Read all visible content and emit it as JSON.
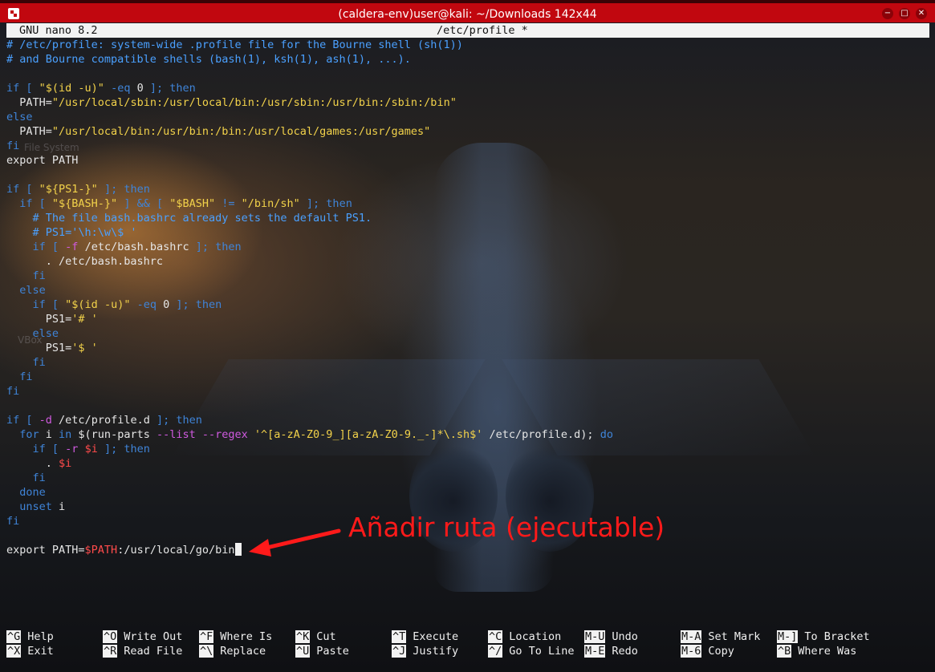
{
  "window": {
    "title": "(caldera-env)user@kali: ~/Downloads 142x44"
  },
  "nano": {
    "version": "GNU nano 8.2",
    "filename": "/etc/profile *"
  },
  "desktop_ghosts": {
    "file_system": "File System",
    "vbox": "VBox"
  },
  "editor_lines": [
    [
      {
        "t": "# /etc/profile: system-wide .profile file for the Bourne shell (sh(1))",
        "c": "c"
      }
    ],
    [
      {
        "t": "# and Bourne compatible shells (bash(1), ksh(1), ash(1), ...).",
        "c": "c"
      }
    ],
    [],
    [
      {
        "t": "if",
        "c": "k"
      },
      {
        "t": " [ ",
        "c": "k"
      },
      {
        "t": "\"$(id -u)\"",
        "c": "s"
      },
      {
        "t": " -eq ",
        "c": "k"
      },
      {
        "t": "0",
        "c": ""
      },
      {
        "t": " ]; then",
        "c": "k"
      }
    ],
    [
      {
        "t": "  PATH=",
        "c": ""
      },
      {
        "t": "\"/usr/local/sbin:/usr/local/bin:/usr/sbin:/usr/bin:/sbin:/bin\"",
        "c": "s"
      }
    ],
    [
      {
        "t": "else",
        "c": "k"
      }
    ],
    [
      {
        "t": "  PATH=",
        "c": ""
      },
      {
        "t": "\"/usr/local/bin:/usr/bin:/bin:/usr/local/games:/usr/games\"",
        "c": "s"
      }
    ],
    [
      {
        "t": "fi",
        "c": "k"
      }
    ],
    [
      {
        "t": "export PATH",
        "c": ""
      }
    ],
    [],
    [
      {
        "t": "if",
        "c": "k"
      },
      {
        "t": " [ ",
        "c": "k"
      },
      {
        "t": "\"${PS1-}\"",
        "c": "s"
      },
      {
        "t": " ]; then",
        "c": "k"
      }
    ],
    [
      {
        "t": "  if",
        "c": "k"
      },
      {
        "t": " [ ",
        "c": "k"
      },
      {
        "t": "\"${BASH-}\"",
        "c": "s"
      },
      {
        "t": " ] && [ ",
        "c": "k"
      },
      {
        "t": "\"$BASH\"",
        "c": "s"
      },
      {
        "t": " != ",
        "c": "k"
      },
      {
        "t": "\"/bin/sh\"",
        "c": "s"
      },
      {
        "t": " ]; then",
        "c": "k"
      }
    ],
    [
      {
        "t": "    # The file bash.bashrc already sets the default PS1.",
        "c": "c"
      }
    ],
    [
      {
        "t": "    # PS1='\\h:\\w\\$ '",
        "c": "c"
      }
    ],
    [
      {
        "t": "    if",
        "c": "k"
      },
      {
        "t": " [ ",
        "c": "k"
      },
      {
        "t": "-f",
        "c": "m"
      },
      {
        "t": " /etc/bash.bashrc ",
        "c": ""
      },
      {
        "t": "]; then",
        "c": "k"
      }
    ],
    [
      {
        "t": "      . /etc/bash.bashrc",
        "c": ""
      }
    ],
    [
      {
        "t": "    fi",
        "c": "k"
      }
    ],
    [
      {
        "t": "  else",
        "c": "k"
      }
    ],
    [
      {
        "t": "    if",
        "c": "k"
      },
      {
        "t": " [ ",
        "c": "k"
      },
      {
        "t": "\"$(id -u)\"",
        "c": "s"
      },
      {
        "t": " -eq ",
        "c": "k"
      },
      {
        "t": "0",
        "c": ""
      },
      {
        "t": " ]; then",
        "c": "k"
      }
    ],
    [
      {
        "t": "      PS1=",
        "c": ""
      },
      {
        "t": "'# '",
        "c": "s"
      }
    ],
    [
      {
        "t": "    else",
        "c": "k"
      }
    ],
    [
      {
        "t": "      PS1=",
        "c": ""
      },
      {
        "t": "'$ '",
        "c": "s"
      }
    ],
    [
      {
        "t": "    fi",
        "c": "k"
      }
    ],
    [
      {
        "t": "  fi",
        "c": "k"
      }
    ],
    [
      {
        "t": "fi",
        "c": "k"
      }
    ],
    [],
    [
      {
        "t": "if",
        "c": "k"
      },
      {
        "t": " [ ",
        "c": "k"
      },
      {
        "t": "-d",
        "c": "m"
      },
      {
        "t": " /etc/profile.d ",
        "c": ""
      },
      {
        "t": "]; then",
        "c": "k"
      }
    ],
    [
      {
        "t": "  for",
        "c": "k"
      },
      {
        "t": " i ",
        "c": ""
      },
      {
        "t": "in",
        "c": "k"
      },
      {
        "t": " $(run-parts ",
        "c": ""
      },
      {
        "t": "--list --regex",
        "c": "m"
      },
      {
        "t": " ",
        "c": ""
      },
      {
        "t": "'^[a-zA-Z0-9_][a-zA-Z0-9._-]*\\.sh$'",
        "c": "s"
      },
      {
        "t": " /etc/profile.d); ",
        "c": ""
      },
      {
        "t": "do",
        "c": "k"
      }
    ],
    [
      {
        "t": "    if",
        "c": "k"
      },
      {
        "t": " [ ",
        "c": "k"
      },
      {
        "t": "-r",
        "c": "m"
      },
      {
        "t": " ",
        "c": ""
      },
      {
        "t": "$i",
        "c": "r"
      },
      {
        "t": " ]; then",
        "c": "k"
      }
    ],
    [
      {
        "t": "      . ",
        "c": ""
      },
      {
        "t": "$i",
        "c": "r"
      }
    ],
    [
      {
        "t": "    fi",
        "c": "k"
      }
    ],
    [
      {
        "t": "  done",
        "c": "k"
      }
    ],
    [
      {
        "t": "  unset",
        "c": "k"
      },
      {
        "t": " i",
        "c": ""
      }
    ],
    [
      {
        "t": "fi",
        "c": "k"
      }
    ],
    [],
    [
      {
        "t": "export PATH=",
        "c": ""
      },
      {
        "t": "$PATH",
        "c": "r"
      },
      {
        "t": ":/usr/local/go/bin",
        "c": ""
      }
    ]
  ],
  "annotation": {
    "text": "Añadir ruta (ejecutable)",
    "color": "#ff1a1a"
  },
  "shortcuts": [
    {
      "key": "^G",
      "label": "Help"
    },
    {
      "key": "^O",
      "label": "Write Out"
    },
    {
      "key": "^F",
      "label": "Where Is"
    },
    {
      "key": "^K",
      "label": "Cut"
    },
    {
      "key": "^T",
      "label": "Execute"
    },
    {
      "key": "^C",
      "label": "Location"
    },
    {
      "key": "M-U",
      "label": "Undo"
    },
    {
      "key": "M-A",
      "label": "Set Mark"
    },
    {
      "key": "M-]",
      "label": "To Bracket"
    },
    {
      "key": "^X",
      "label": "Exit"
    },
    {
      "key": "^R",
      "label": "Read File"
    },
    {
      "key": "^\\",
      "label": "Replace"
    },
    {
      "key": "^U",
      "label": "Paste"
    },
    {
      "key": "^J",
      "label": "Justify"
    },
    {
      "key": "^/",
      "label": "Go To Line"
    },
    {
      "key": "M-E",
      "label": "Redo"
    },
    {
      "key": "M-6",
      "label": "Copy"
    },
    {
      "key": "^B",
      "label": "Where Was"
    }
  ],
  "colors": {
    "titlebar": "#c1070f",
    "comment": "#4aa0ff",
    "keyword": "#3f84d8",
    "string": "#f2d24a",
    "option": "#d05ae0",
    "variable": "#ff4b4b"
  }
}
